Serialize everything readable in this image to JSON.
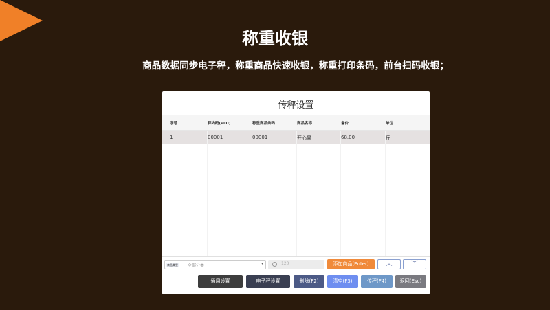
{
  "slide": {
    "title": "称重收银",
    "subtitle": "商品数据同步电子秤，称重商品快速收银，称重打印条码，前台扫码收银；",
    "accent_color": "#f08028",
    "background_color": "#2a1a0c"
  },
  "window": {
    "title": "传秤设置"
  },
  "table": {
    "columns": [
      "序号",
      "秤内码(PLU)",
      "称重商品条码",
      "商品名称",
      "售价",
      "单位"
    ],
    "rows": [
      [
        "1",
        "00001",
        "00001",
        "开心果",
        "68.00",
        "斤"
      ]
    ]
  },
  "toolbar": {
    "category_label": "商品类型",
    "category_value": "全部分类",
    "search_placeholder": "120",
    "add_button": "添加商品(Enter)",
    "up_icon": "chevron-up-icon",
    "down_icon": "chevron-down-icon"
  },
  "buttons": {
    "general_settings": "通用设置",
    "scale_settings": "电子秤设置",
    "delete": "删除(F2)",
    "clear": "清空(F3)",
    "send_scale": "传秤(F4)",
    "back": "返回(Esc)"
  }
}
